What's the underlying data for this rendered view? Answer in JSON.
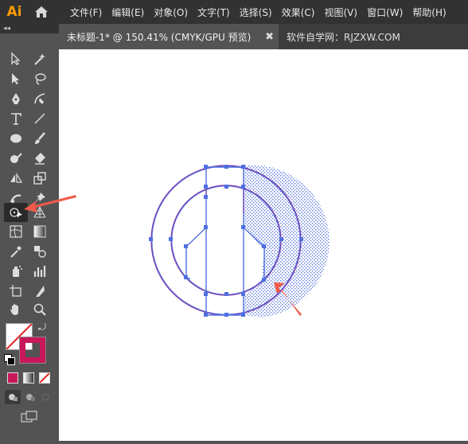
{
  "app": {
    "logo": "Ai"
  },
  "menu": [
    "文件(F)",
    "编辑(E)",
    "对象(O)",
    "文字(T)",
    "选择(S)",
    "效果(C)",
    "视图(V)",
    "窗口(W)",
    "帮助(H)"
  ],
  "tabs": [
    {
      "label": "未标题-1* @ 150.41% (CMYK/GPU 预览)",
      "close": "✖"
    },
    {
      "label": "软件自学网：RJZXW.COM"
    }
  ],
  "toolbar": {
    "collapse": "◂◂",
    "tools": [
      "selection-tool",
      "direct-selection-tool",
      "magic-wand-tool",
      "lasso-tool",
      "pen-tool",
      "curvature-tool",
      "type-tool",
      "line-segment-tool",
      "ellipse-tool",
      "paintbrush-tool",
      "shaper-tool",
      "eraser-tool",
      "reflect-tool",
      "scale-tool",
      "puppet-warp-tool",
      "pin-tool",
      "shape-builder-tool",
      "perspective-grid-tool",
      "mesh-tool",
      "gradient-tool",
      "eyedropper-tool",
      "blend-tool",
      "symbol-sprayer-tool",
      "column-graph-tool",
      "artboard-tool",
      "slice-tool",
      "hand-tool",
      "zoom-tool"
    ],
    "fill_color": "#ffffff",
    "stroke_color": "#c8185a"
  },
  "colors": {
    "accent": "#ff9a00",
    "selection": "#4f6fe0",
    "stroke": "#7a3fb0",
    "arrow": "#f05a4a"
  }
}
